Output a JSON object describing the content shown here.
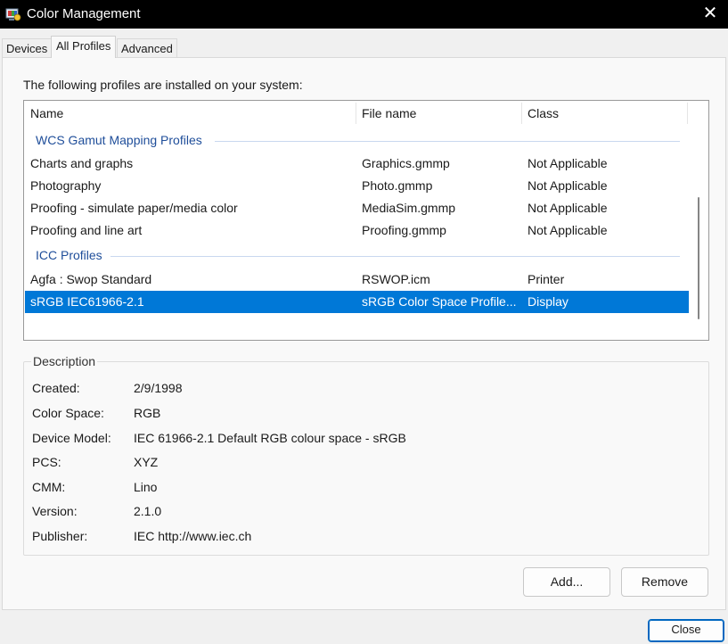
{
  "window": {
    "title": "Color Management",
    "close_glyph": "✕"
  },
  "tabs": [
    {
      "label": "Devices",
      "active": false
    },
    {
      "label": "All Profiles",
      "active": true
    },
    {
      "label": "Advanced",
      "active": false
    }
  ],
  "profiles": {
    "intro": "The following profiles are installed on your system:",
    "columns": [
      "Name",
      "File name",
      "Class"
    ],
    "groups": [
      {
        "title": "WCS Gamut Mapping Profiles",
        "rows": [
          {
            "name": "Charts and graphs",
            "file": "Graphics.gmmp",
            "class": "Not Applicable"
          },
          {
            "name": "Photography",
            "file": "Photo.gmmp",
            "class": "Not Applicable"
          },
          {
            "name": "Proofing - simulate paper/media color",
            "file": "MediaSim.gmmp",
            "class": "Not Applicable"
          },
          {
            "name": "Proofing and line art",
            "file": "Proofing.gmmp",
            "class": "Not Applicable"
          }
        ]
      },
      {
        "title": "ICC Profiles",
        "rows": [
          {
            "name": "Agfa : Swop Standard",
            "file": "RSWOP.icm",
            "class": "Printer"
          },
          {
            "name": "sRGB IEC61966-2.1",
            "file": "sRGB Color Space Profile...",
            "class": "Display",
            "selected": true
          }
        ]
      }
    ]
  },
  "description": {
    "legend": "Description",
    "fields": [
      {
        "label": "Created:",
        "value": "2/9/1998"
      },
      {
        "label": "Color Space:",
        "value": "RGB"
      },
      {
        "label": "Device Model:",
        "value": "IEC 61966-2.1 Default RGB colour space - sRGB"
      },
      {
        "label": "PCS:",
        "value": "XYZ"
      },
      {
        "label": "CMM:",
        "value": "Lino"
      },
      {
        "label": "Version:",
        "value": "2.1.0"
      },
      {
        "label": "Publisher:",
        "value": "IEC http://www.iec.ch"
      }
    ]
  },
  "buttons": {
    "add": "Add...",
    "remove": "Remove",
    "close": "Close"
  },
  "colors": {
    "selection": "#0078d7",
    "group_title": "#1f4e9a",
    "titlebar": "#000000"
  },
  "icons": {
    "app": "color-management-icon",
    "close": "close-icon"
  }
}
